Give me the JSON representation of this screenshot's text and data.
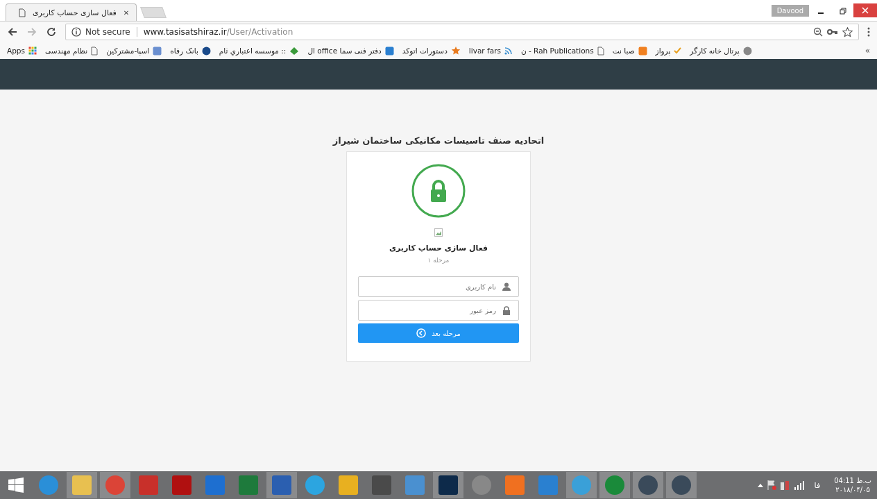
{
  "browser": {
    "tab": {
      "title": "فعال سازی حساب کاربری",
      "close": "✕"
    },
    "profile": "Davood",
    "url": {
      "security": "Not secure",
      "host": "www.tasisatshiraz.ir",
      "path": "/User/Activation"
    },
    "bookmarks": [
      {
        "kind": "globe",
        "label": "پرتال خانه کارگر"
      },
      {
        "kind": "check",
        "label": "پرواز"
      },
      {
        "kind": "orange",
        "label": "صبا نت"
      },
      {
        "kind": "page",
        "label": "Rah Publications - ن"
      },
      {
        "kind": "rss",
        "label": "livar fars"
      },
      {
        "kind": "star",
        "label": "دستورات اتوکد"
      },
      {
        "kind": "blue",
        "label": "دفتر فنی سما office ال"
      },
      {
        "kind": "leaf",
        "label": ":: موسسه اعتباري ثام"
      },
      {
        "kind": "bank",
        "label": "بانک رفاه"
      },
      {
        "kind": "feather",
        "label": "اسپا-مشترکین"
      },
      {
        "kind": "page",
        "label": "نظام مهندسی"
      },
      {
        "kind": "apps",
        "label": "Apps"
      }
    ],
    "overflow": "»"
  },
  "page": {
    "heading": "اتحادیه صنف تاسیسات مکانیکی ساختمان شیراز",
    "card_title": "فعال سازی حساب کاربری",
    "step": "مرحله ۱",
    "fields": [
      {
        "kind": "user",
        "placeholder": "نام کاربری"
      },
      {
        "kind": "lock",
        "placeholder": "رمز عبور"
      }
    ],
    "submit": "مرحله بعد"
  },
  "taskbar": {
    "apps": [
      {
        "kind": "ie",
        "active": false
      },
      {
        "kind": "folder",
        "active": true
      },
      {
        "kind": "chrome",
        "active": true
      },
      {
        "kind": "red",
        "active": false
      },
      {
        "kind": "darkred",
        "active": false
      },
      {
        "kind": "scan",
        "active": false
      },
      {
        "kind": "excel",
        "active": false
      },
      {
        "kind": "word",
        "active": true
      },
      {
        "kind": "telegram",
        "active": false
      },
      {
        "kind": "bolt",
        "active": false
      },
      {
        "kind": "mouse",
        "active": false
      },
      {
        "kind": "calc",
        "active": false
      },
      {
        "kind": "ps",
        "active": true
      },
      {
        "kind": "ring",
        "active": false
      },
      {
        "kind": "player",
        "active": false
      },
      {
        "kind": "bars",
        "active": false
      },
      {
        "kind": "jb",
        "active": true
      },
      {
        "kind": "jbgreen",
        "active": true
      },
      {
        "kind": "disc",
        "active": true
      },
      {
        "kind": "disc",
        "active": true
      }
    ],
    "lang": "فا",
    "time": "04:11 ب.ظ",
    "date": "۲۰۱۸/۰۴/۰۵"
  }
}
